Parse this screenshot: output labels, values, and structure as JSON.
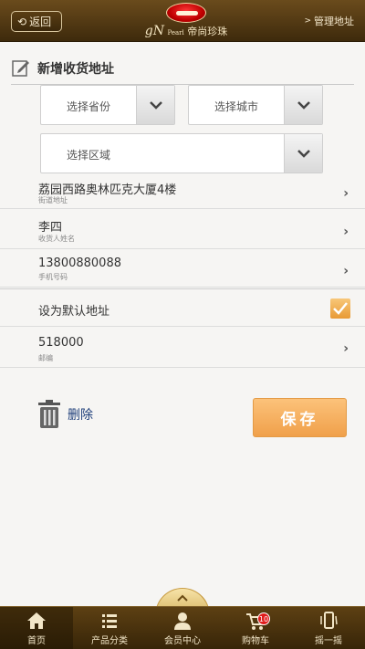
{
  "header": {
    "back_label": "返回",
    "logo_brand": "gN",
    "logo_pearl": "Pearl",
    "logo_text": "帝尚珍珠",
    "manage_label": "管理地址"
  },
  "form": {
    "title": "新增收货地址",
    "province_placeholder": "选择省份",
    "city_placeholder": "选择城市",
    "district_placeholder": "选择区域",
    "street": {
      "value": "荔园西路奥林匹克大厦4楼",
      "label": "街道地址"
    },
    "name": {
      "value": "李四",
      "label": "收货人姓名"
    },
    "phone": {
      "value": "13800880088",
      "label": "手机号码"
    },
    "default_label": "设为默认地址",
    "default_checked": true,
    "zip": {
      "value": "518000",
      "label": "邮编"
    }
  },
  "actions": {
    "delete_label": "删除",
    "save_label": "保存"
  },
  "nav": {
    "items": [
      {
        "label": "首页",
        "icon": "home-icon"
      },
      {
        "label": "产品分类",
        "icon": "list-icon"
      },
      {
        "label": "会员中心",
        "icon": "user-icon"
      },
      {
        "label": "购物车",
        "icon": "cart-icon",
        "badge": "10"
      },
      {
        "label": "摇一摇",
        "icon": "shake-phone-icon"
      }
    ]
  },
  "colors": {
    "header_bg": "#5a3e14",
    "accent_orange": "#f0a04a",
    "link_blue": "#1f3f7a"
  }
}
